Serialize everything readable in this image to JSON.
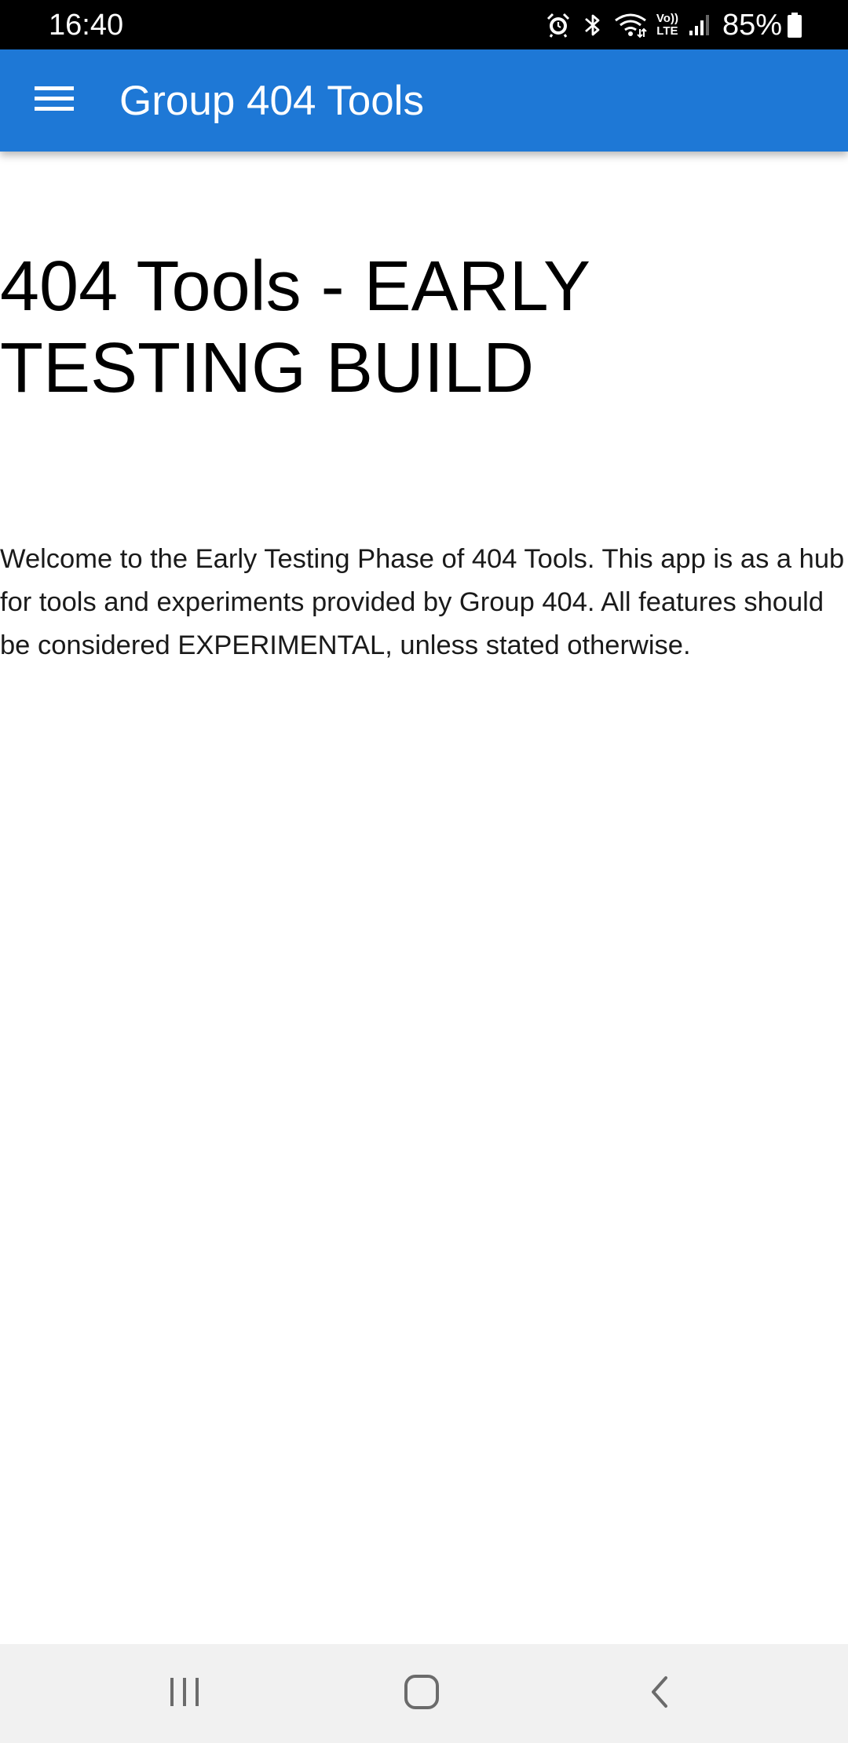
{
  "status_bar": {
    "time": "16:40",
    "battery": "85%",
    "volte_top": "Vo))",
    "volte_bottom": "LTE",
    "icons": [
      "alarm-icon",
      "bluetooth-icon",
      "wifi-icon",
      "volte-icon",
      "signal-icon",
      "battery-icon"
    ]
  },
  "app_bar": {
    "title": "Group 404 Tools",
    "menu_icon": "hamburger-menu-icon",
    "color": "#1e78d6"
  },
  "main": {
    "heading": "404 Tools - EARLY TESTING BUILD",
    "welcome": "Welcome to the Early Testing Phase of 404 Tools. This app is as a hub for tools and experiments provided by Group 404. All features should be considered EXPERIMENTAL, unless stated otherwise."
  },
  "nav_bar": {
    "buttons": [
      "recent-apps-icon",
      "home-icon",
      "back-icon"
    ]
  }
}
